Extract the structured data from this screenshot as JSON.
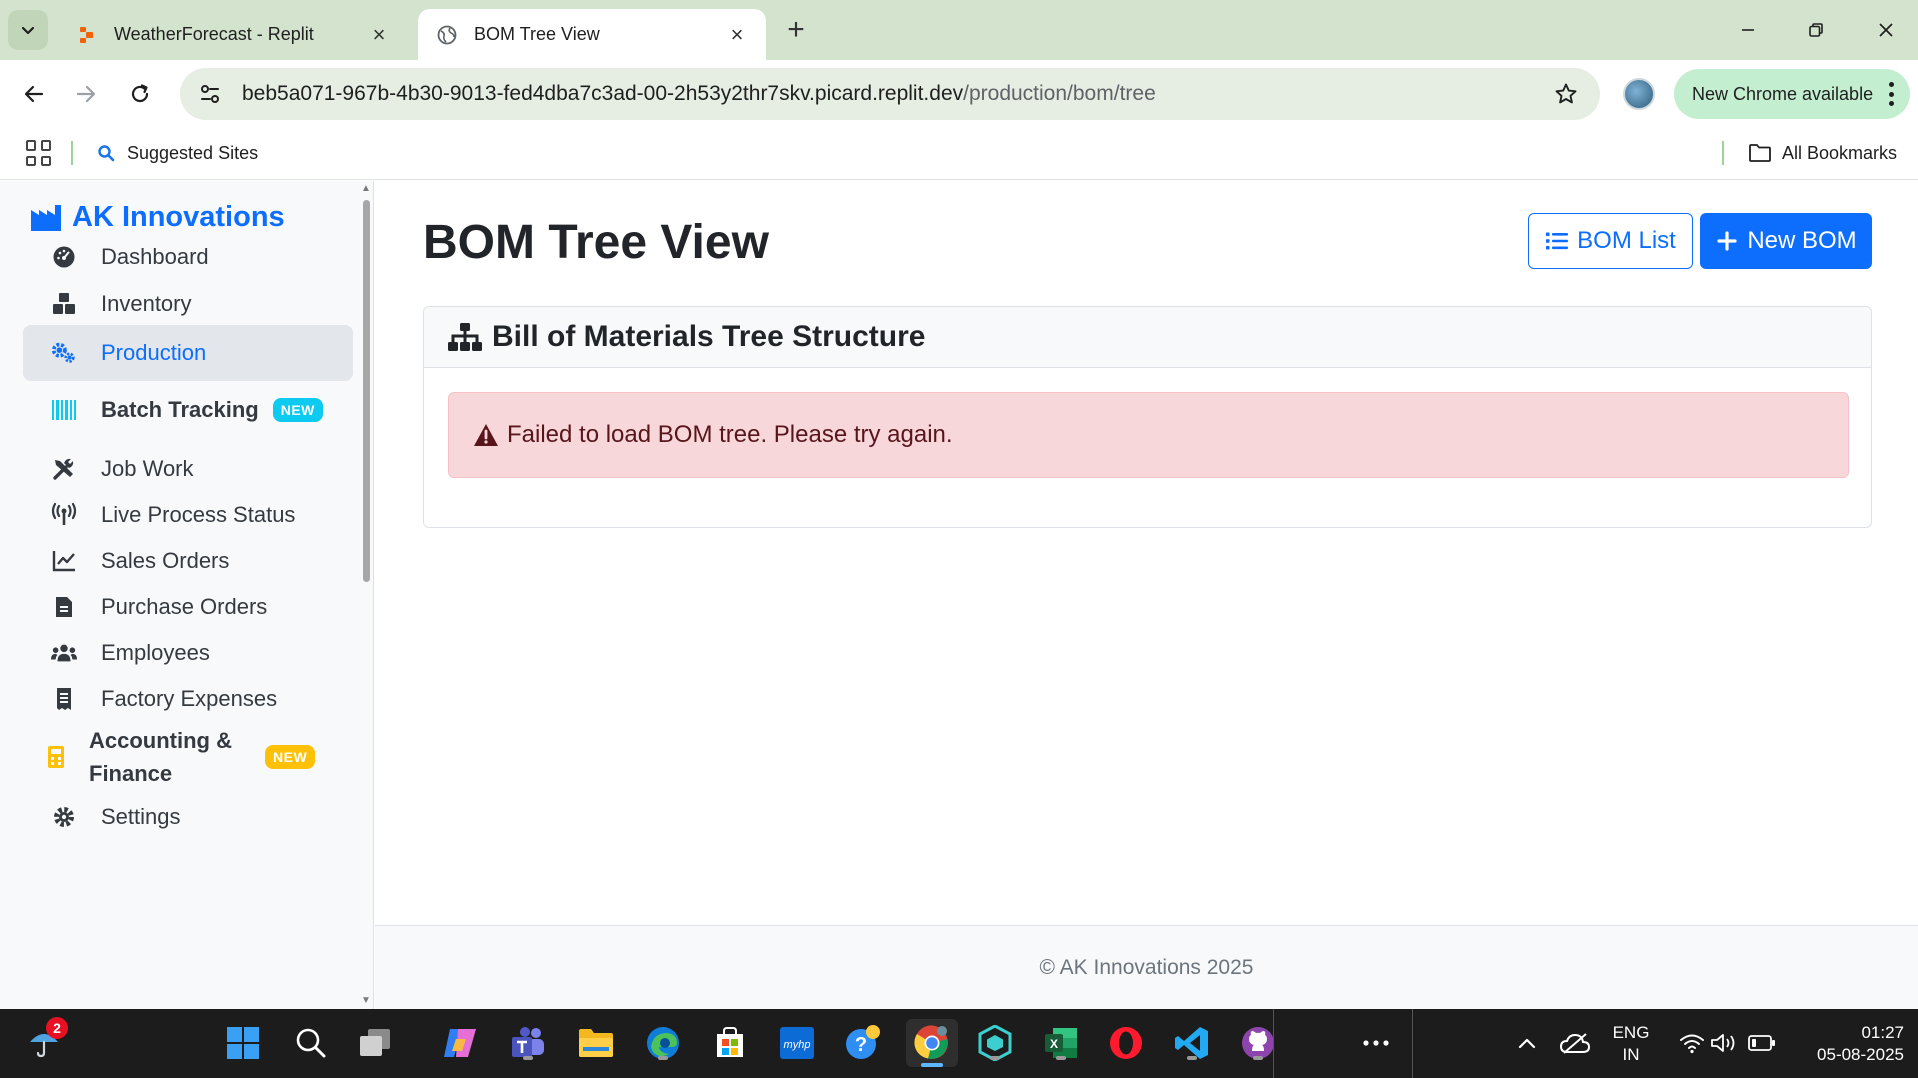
{
  "browser": {
    "tabs": [
      {
        "title": "WeatherForecast - Replit",
        "active": false
      },
      {
        "title": "BOM Tree View",
        "active": true
      }
    ],
    "url_host": "beb5a071-967b-4b30-9013-fed4dba7c3ad-00-2h53y2thr7skv.picard.replit.dev",
    "url_path": "/production/bom/tree",
    "update_label": "New Chrome available",
    "bookmarks": {
      "suggested": "Suggested Sites",
      "all": "All Bookmarks"
    }
  },
  "app": {
    "brand": "AK Innovations",
    "nav": [
      {
        "label": "Dashboard",
        "icon": "dashboard-icon"
      },
      {
        "label": "Inventory",
        "icon": "boxes-icon"
      },
      {
        "label": "Production",
        "icon": "gears-icon",
        "active": true
      },
      {
        "label": "Batch Tracking",
        "icon": "barcode-icon",
        "badge": "NEW"
      },
      {
        "label": "Job Work",
        "icon": "tools-icon"
      },
      {
        "label": "Live Process Status",
        "icon": "broadcast-icon"
      },
      {
        "label": "Sales Orders",
        "icon": "line-chart-icon"
      },
      {
        "label": "Purchase Orders",
        "icon": "document-icon"
      },
      {
        "label": "Employees",
        "icon": "users-icon"
      },
      {
        "label": "Factory Expenses",
        "icon": "receipt-icon"
      },
      {
        "label": "Accounting & Finance",
        "icon": "calculator-icon",
        "badge": "NEW"
      },
      {
        "label": "Settings",
        "icon": "gear-icon"
      }
    ],
    "page_title": "BOM Tree View",
    "buttons": {
      "bom_list": "BOM List",
      "new_bom": "New BOM"
    },
    "card_title": "Bill of Materials Tree Structure",
    "error_message": "Failed to load BOM tree. Please try again.",
    "footer": "© AK Innovations 2025",
    "colors": {
      "primary": "#0d6efd",
      "danger_bg": "#f8d7da",
      "danger_text": "#58151c",
      "badge_info": "#0dcaf0",
      "badge_warning": "#ffc107"
    }
  },
  "taskbar": {
    "notification_count": "2",
    "language": "ENG",
    "region": "IN",
    "time": "01:27",
    "date": "05-08-2025"
  }
}
